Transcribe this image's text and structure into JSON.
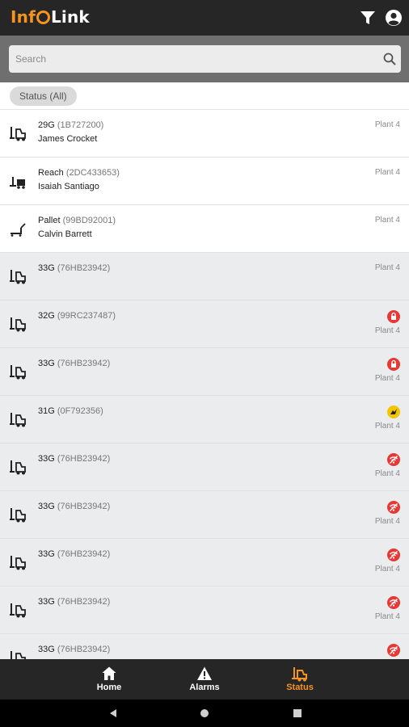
{
  "app": {
    "logo_left": "Inf",
    "logo_right": "Link",
    "filter_icon": "filter-icon",
    "account_icon": "account-circle-icon"
  },
  "search": {
    "placeholder": "Search",
    "icon": "search-icon"
  },
  "filter_chip": {
    "label": "Status (All)"
  },
  "colors": {
    "brand": "#f7941d",
    "alarm_red": "#e53935",
    "warning_yellow": "#f5c400",
    "bar": "#262626"
  },
  "vehicles": [
    {
      "model": "29G",
      "serial": "(1B727200)",
      "operator": "James Crocket",
      "plant": "Plant 4",
      "state": "active",
      "icon": "forklift-icon",
      "status_icon": ""
    },
    {
      "model": "Reach",
      "serial": "(2DC433653)",
      "operator": "Isaiah Santiago",
      "plant": "Plant 4",
      "state": "active",
      "icon": "reach-truck-icon",
      "status_icon": ""
    },
    {
      "model": "Pallet",
      "serial": "(99BD92001)",
      "operator": "Calvin Barrett",
      "plant": "Plant 4",
      "state": "active",
      "icon": "pallet-jack-icon",
      "status_icon": ""
    },
    {
      "model": "33G",
      "serial": "(76HB23942)",
      "operator": "",
      "plant": "Plant 4",
      "state": "inactive",
      "icon": "forklift-icon",
      "status_icon": ""
    },
    {
      "model": "32G",
      "serial": "(99RC237487)",
      "operator": "",
      "plant": "Plant 4",
      "state": "inactive",
      "icon": "forklift-icon",
      "status_icon": "lock-icon"
    },
    {
      "model": "33G",
      "serial": "(76HB23942)",
      "operator": "",
      "plant": "Plant 4",
      "state": "inactive",
      "icon": "forklift-icon",
      "status_icon": "lock-icon"
    },
    {
      "model": "31G",
      "serial": "(0F792356)",
      "operator": "",
      "plant": "Plant 4",
      "state": "inactive",
      "icon": "forklift-icon",
      "status_icon": "impact-warning-icon"
    },
    {
      "model": "33G",
      "serial": "(76HB23942)",
      "operator": "",
      "plant": "Plant 4",
      "state": "inactive",
      "icon": "forklift-icon",
      "status_icon": "no-signal-icon"
    },
    {
      "model": "33G",
      "serial": "(76HB23942)",
      "operator": "",
      "plant": "Plant 4",
      "state": "inactive",
      "icon": "forklift-icon",
      "status_icon": "no-signal-icon"
    },
    {
      "model": "33G",
      "serial": "(76HB23942)",
      "operator": "",
      "plant": "Plant 4",
      "state": "inactive",
      "icon": "forklift-icon",
      "status_icon": "no-signal-icon"
    },
    {
      "model": "33G",
      "serial": "(76HB23942)",
      "operator": "",
      "plant": "Plant 4",
      "state": "inactive",
      "icon": "forklift-icon",
      "status_icon": "no-signal-icon"
    },
    {
      "model": "33G",
      "serial": "(76HB23942)",
      "operator": "",
      "plant": "",
      "state": "inactive",
      "icon": "forklift-icon",
      "status_icon": "no-signal-icon"
    }
  ],
  "bottom_nav": [
    {
      "label": "Home",
      "icon": "home-icon",
      "selected": false
    },
    {
      "label": "Alarms",
      "icon": "alarm-warning-icon",
      "selected": false
    },
    {
      "label": "Status",
      "icon": "forklift-status-icon",
      "selected": true
    }
  ],
  "system_nav": [
    "back-icon",
    "home-circle-icon",
    "recents-square-icon"
  ]
}
